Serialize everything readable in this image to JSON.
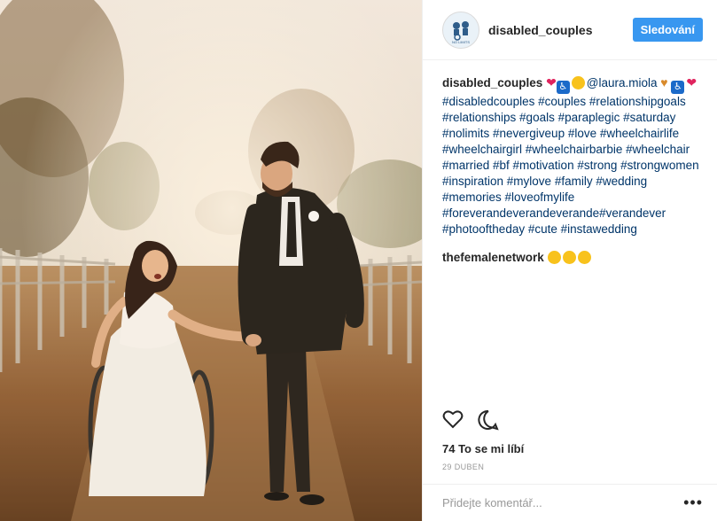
{
  "header": {
    "username": "disabled_couples",
    "follow_label": "Sledování",
    "avatar_text": "NO LIMITS"
  },
  "caption": {
    "author": "disabled_couples",
    "mention": "@laura.miola",
    "hashtags": "#disabledcouples #couples #relationshipgoals #relationships #goals #paraplegic #saturday #nolimits #nevergiveup #love #wheelchairlife #wheelchairgirl #wheelchairbarbie #wheelchair #married #bf #motivation #strong #strongwomen #inspiration #mylove #family #wedding #memories #loveofmylife #foreverandeverandeverande#verandever #photooftheday #cute #instawedding"
  },
  "reply": {
    "author": "thefemalenetwork"
  },
  "likes": "74 To se mi líbí",
  "date": "29 DUBEN",
  "comment_placeholder": "Přidejte komentář...",
  "colors": {
    "accent": "#3897f0",
    "hashtag": "#003569"
  },
  "icons": [
    "heart-icon",
    "comment-icon",
    "more-options-icon",
    "wheelchair-icon"
  ]
}
